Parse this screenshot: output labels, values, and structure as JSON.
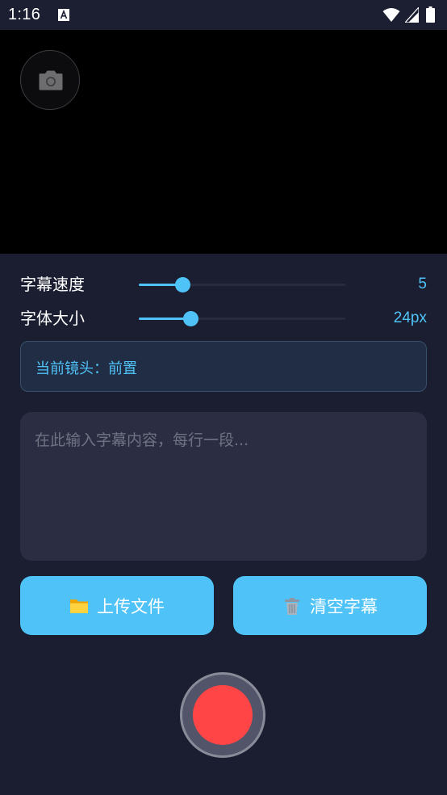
{
  "status_bar": {
    "time": "1:16"
  },
  "controls": {
    "speed": {
      "label": "字幕速度",
      "value": "5",
      "slider_fraction": 0.21
    },
    "font_size": {
      "label": "字体大小",
      "value": "24px",
      "slider_fraction": 0.25
    }
  },
  "lens": {
    "text": "当前镜头：前置"
  },
  "subtitle_input": {
    "placeholder": "在此输入字幕内容，每行一段...",
    "value": ""
  },
  "buttons": {
    "upload_label": "上传文件",
    "upload_icon": "folder-icon",
    "clear_label": "清空字幕",
    "clear_icon": "trash-icon"
  },
  "colors": {
    "accent": "#4fc3f7",
    "background": "#1b1e30",
    "record": "#ff4545"
  }
}
